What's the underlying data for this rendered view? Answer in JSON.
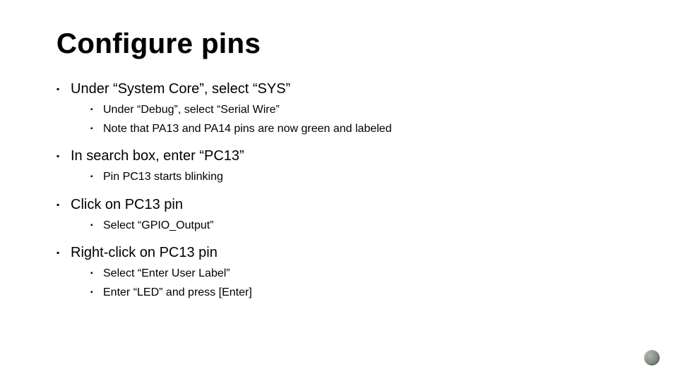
{
  "title": "Configure pins",
  "bullets": [
    {
      "text": "Under “System Core”, select “SYS”",
      "children": [
        "Under “Debug”, select “Serial Wire”",
        "Note that PA13 and PA14 pins are now green and labeled"
      ]
    },
    {
      "text": "In search box, enter “PC13”",
      "children": [
        "Pin PC13 starts blinking"
      ]
    },
    {
      "text": "Click on PC13 pin",
      "children": [
        "Select “GPIO_Output”"
      ]
    },
    {
      "text": "Right-click on PC13 pin",
      "children": [
        "Select “Enter User Label”",
        "Enter “LED” and press [Enter]"
      ]
    }
  ]
}
